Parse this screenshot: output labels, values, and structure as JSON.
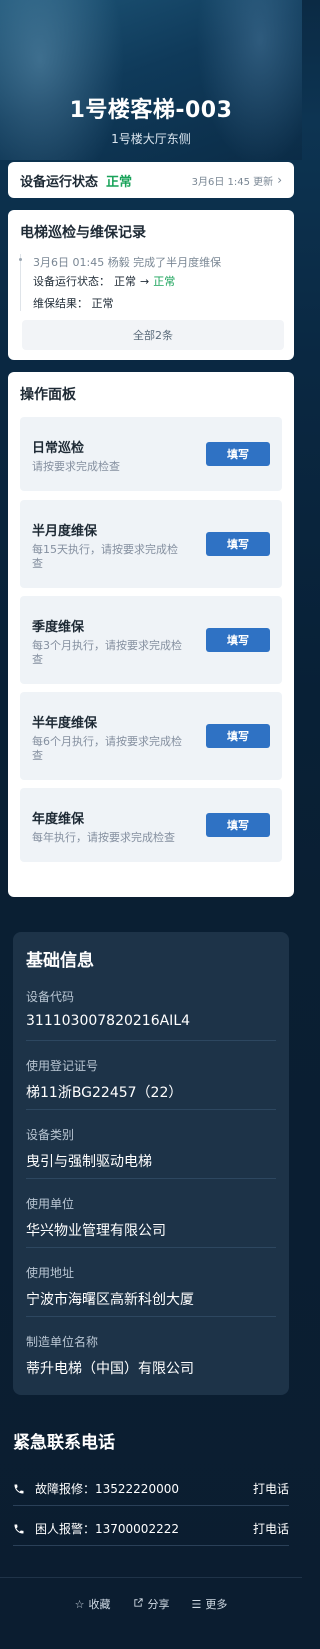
{
  "header": {
    "title": "1号楼客梯-003",
    "subtitle": "1号楼大厅东侧"
  },
  "status": {
    "label": "设备运行状态",
    "value": "正常",
    "updated": "3月6日 1:45 更新",
    "value_color": "#1aa35a"
  },
  "records": {
    "title": "电梯巡检与维保记录",
    "items": [
      {
        "line1": "3月6日 01:45  杨毅 完成了半月度维保",
        "status_label": "设备运行状态：",
        "status_from": "正常",
        "arrow": "→",
        "status_to": "正常",
        "result_label": "维保结果：",
        "result_value": "正常"
      }
    ],
    "all_label": "全部2条"
  },
  "operations": {
    "title": "操作面板",
    "button_label": "填写",
    "items": [
      {
        "title": "日常巡检",
        "desc": "请按要求完成检查"
      },
      {
        "title": "半月度维保",
        "desc": "每15天执行，请按要求完成检查"
      },
      {
        "title": "季度维保",
        "desc": "每3个月执行，请按要求完成检查"
      },
      {
        "title": "半年度维保",
        "desc": "每6个月执行，请按要求完成检查"
      },
      {
        "title": "年度维保",
        "desc": "每年执行，请按要求完成检查"
      }
    ]
  },
  "basic_info": {
    "title": "基础信息",
    "fields": [
      {
        "label": "设备代码",
        "value": "311103007820216AIL4"
      },
      {
        "label": "使用登记证号",
        "value": "梯11浙BG22457（22）"
      },
      {
        "label": "设备类别",
        "value": "曳引与强制驱动电梯"
      },
      {
        "label": "使用单位",
        "value": "华兴物业管理有限公司"
      },
      {
        "label": "使用地址",
        "value": "宁波市海曙区高新科创大厦"
      },
      {
        "label": "制造单位名称",
        "value": "蒂升电梯（中国）有限公司"
      }
    ]
  },
  "emergency": {
    "title": "紧急联系电话",
    "contacts": [
      {
        "text": "故障报修：13522220000",
        "action": "打电话"
      },
      {
        "text": "困人报警：13700002222",
        "action": "打电话"
      }
    ]
  },
  "footer": {
    "items": [
      {
        "icon": "star-icon",
        "label": "收藏"
      },
      {
        "icon": "share-icon",
        "label": "分享"
      },
      {
        "icon": "menu-icon",
        "label": "更多"
      }
    ]
  }
}
